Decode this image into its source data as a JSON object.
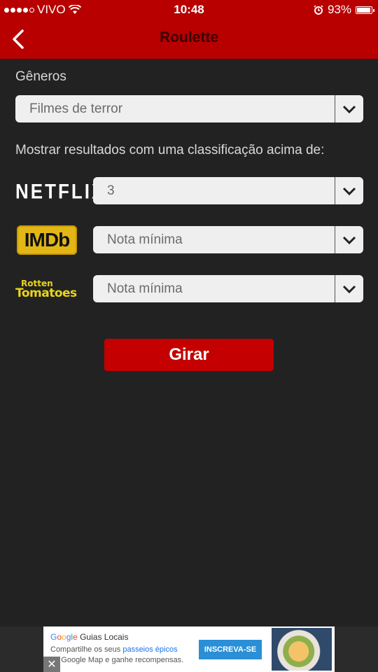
{
  "status_bar": {
    "carrier": "VIVO",
    "time": "10:48",
    "battery": "93%",
    "battery_level": 0.93
  },
  "nav": {
    "title": "Roulette"
  },
  "genres": {
    "label": "Gêneros",
    "selected": "Filmes de terror"
  },
  "rating_section": {
    "label": "Mostrar resultados com uma classificação acima de:",
    "netflix": {
      "logo_text": "NETFLIX",
      "selected": "3"
    },
    "imdb": {
      "logo_text": "IMDb",
      "selected": "Nota mínima"
    },
    "rotten_tomatoes": {
      "logo_line1": "Rotten",
      "logo_line2": "Tomatoes",
      "selected": "Nota mínima"
    }
  },
  "spin_button": {
    "label": "Girar"
  },
  "ad": {
    "brand_g": "G",
    "brand_o1": "o",
    "brand_o2": "o",
    "brand_g2": "g",
    "brand_l": "l",
    "brand_e": "e",
    "brand_suffix": " Guias Locais",
    "line1_prefix": "Compartilhe os seus ",
    "line1_highlight": "passeios épicos",
    "line2": "no Google Map e ganhe recompensas.",
    "cta": "INSCREVA-SE",
    "close": "✕"
  },
  "colors": {
    "accent": "#b80000",
    "background": "#222222",
    "button": "#c40000"
  }
}
